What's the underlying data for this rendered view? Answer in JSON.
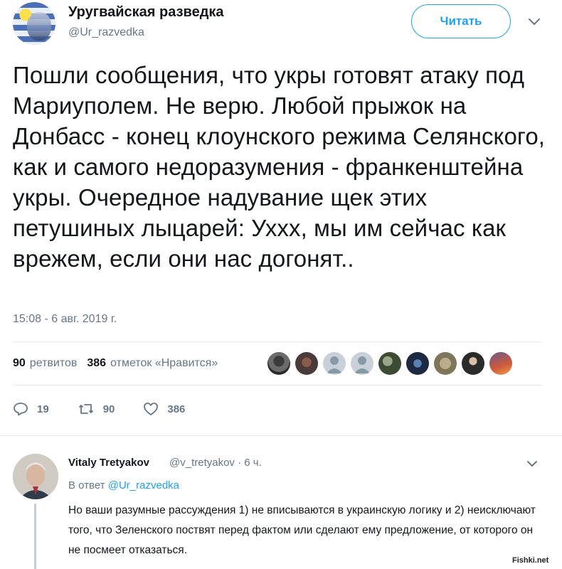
{
  "account": {
    "display_name": "Уругвайская разведка",
    "handle": "@Ur_razvedka",
    "follow_label": "Читать"
  },
  "tweet": {
    "text": "Пошли сообщения, что укры готовят атаку под Мариуполем. Не верю. Любой прыжок на Донбасс - конец клоунского режима Селянского, как и самого недоразумения - франкенштейна укры. Очередное надувание щек этих петушиных лыцарей: Уххх, мы им сейчас как врежем, если они нас догонят..",
    "timestamp": "15:08 - 6 авг. 2019 г."
  },
  "stats": {
    "retweets_count": "90",
    "retweets_label": "ретвитов",
    "likes_count": "386",
    "likes_label": "отметок «Нравится»"
  },
  "actions": {
    "reply_count": "19",
    "retweet_count": "90",
    "like_count": "386"
  },
  "reply": {
    "display_name": "Vitaly Tretyakov",
    "handle_time": "@v_tretyakov · 6 ч.",
    "in_reply_prefix": "В ответ",
    "in_reply_mention": "@Ur_razvedka",
    "text": "Но ваши разумные рассуждения 1) не вписываются в украинскую логику и 2) неисключают того, что Зеленского поствят перед фактом или сделают ему предложение, от которого он не посмеет отказаться."
  },
  "watermark": "Fishki.net",
  "colors": {
    "accent": "#1da1f2",
    "secondary_text": "#657786",
    "primary_text": "#14171a",
    "divider": "#e6ecf0"
  }
}
